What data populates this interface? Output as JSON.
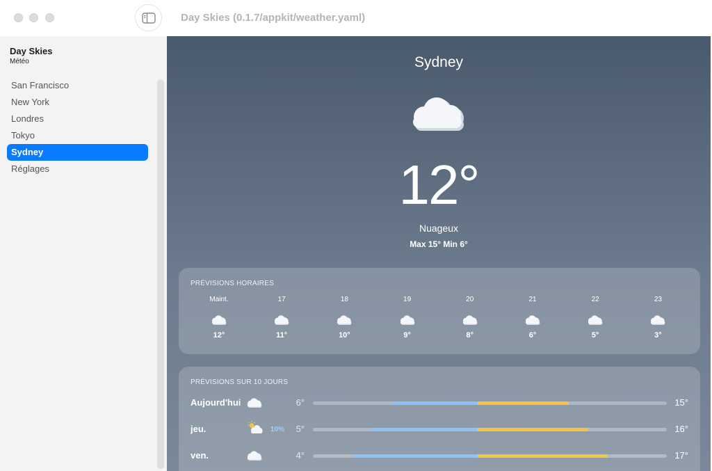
{
  "window": {
    "title": "Day Skies (0.1.7/appkit/weather.yaml)"
  },
  "sidebar": {
    "app_name": "Day Skies",
    "app_subtitle": "Météo",
    "items": [
      {
        "label": "San Francisco",
        "active": false
      },
      {
        "label": "New York",
        "active": false
      },
      {
        "label": "Londres",
        "active": false
      },
      {
        "label": "Tokyo",
        "active": false
      },
      {
        "label": "Sydney",
        "active": true
      },
      {
        "label": "Réglages",
        "active": false
      }
    ]
  },
  "weather": {
    "city": "Sydney",
    "icon": "cloud-icon",
    "temperature": "12°",
    "condition": "Nuageux",
    "minmax": "Max 15° Min 6°"
  },
  "hourly": {
    "title": "PRÉVISIONS HORAIRES",
    "hours": [
      {
        "label": "Maint.",
        "temp": "12°",
        "icon": "cloud-icon"
      },
      {
        "label": "17",
        "temp": "11°",
        "icon": "cloud-icon"
      },
      {
        "label": "18",
        "temp": "10°",
        "icon": "cloud-icon"
      },
      {
        "label": "19",
        "temp": "9°",
        "icon": "cloud-icon"
      },
      {
        "label": "20",
        "temp": "8°",
        "icon": "cloud-icon"
      },
      {
        "label": "21",
        "temp": "6°",
        "icon": "cloud-icon"
      },
      {
        "label": "22",
        "temp": "5°",
        "icon": "cloud-icon"
      },
      {
        "label": "23",
        "temp": "3°",
        "icon": "cloud-icon"
      }
    ]
  },
  "daily": {
    "title": "PRÉVISIONS SUR 10 JOURS",
    "range_min": 2,
    "range_max": 20,
    "days": [
      {
        "label": "Aujourd'hui",
        "icon": "cloud-icon",
        "precip": "",
        "low": "6°",
        "high": "15°",
        "low_value": 6,
        "high_value": 15
      },
      {
        "label": "jeu.",
        "icon": "sun-cloud-icon",
        "precip": "10%",
        "low": "5°",
        "high": "16°",
        "low_value": 5,
        "high_value": 16
      },
      {
        "label": "ven.",
        "icon": "cloud-icon",
        "precip": "",
        "low": "4°",
        "high": "17°",
        "low_value": 4,
        "high_value": 17
      }
    ]
  },
  "colors": {
    "accent": "#0a7aff",
    "bar_cool": "#8ec2f4",
    "bar_warm": "#f5c542"
  }
}
